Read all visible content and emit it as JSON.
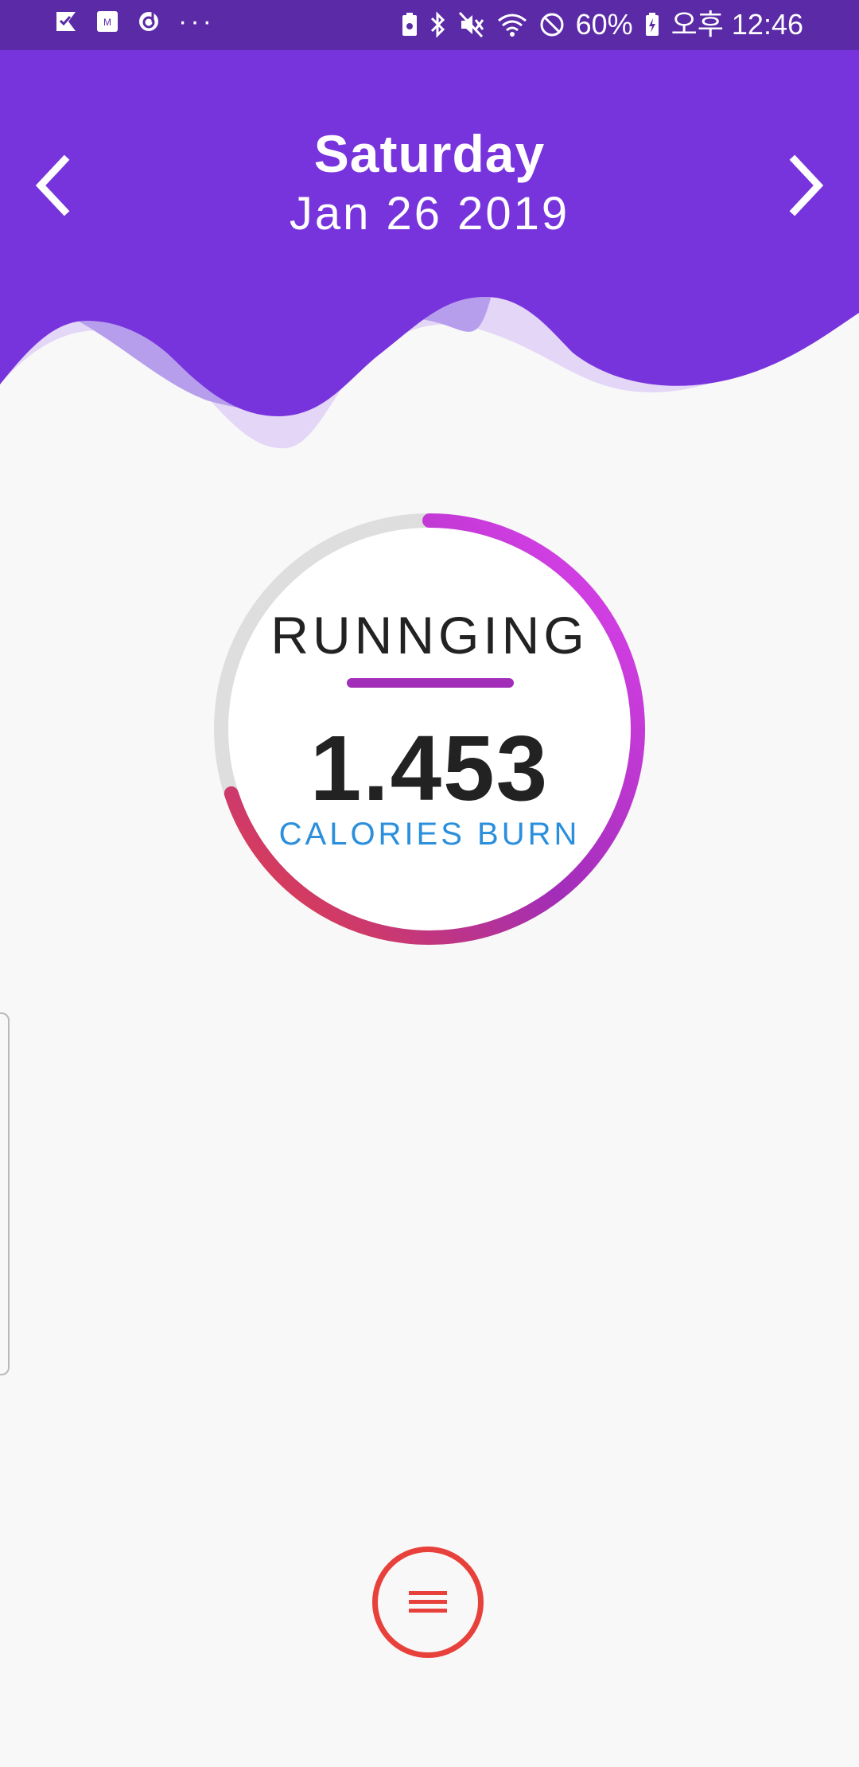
{
  "status_bar": {
    "left_icons": [
      "check-flag-icon",
      "mp-app-icon",
      "refresh-clock-icon"
    ],
    "more_indicator": "···",
    "right_icons": [
      "battery-saver-icon",
      "bluetooth-icon",
      "mute-icon",
      "wifi-icon",
      "block-icon"
    ],
    "battery_text": "60%",
    "time_text": "오후 12:46"
  },
  "header": {
    "day": "Saturday",
    "date": "Jan 26 2019",
    "prev_icon": "chevron-left-icon",
    "next_icon": "chevron-right-icon"
  },
  "activity": {
    "name": "RUNNGING",
    "value": "1.453",
    "unit": "CALORIES BURN",
    "progress_percent": 70
  },
  "menu": {
    "icon": "menu-icon"
  },
  "colors": {
    "header_purple": "#7834dc",
    "status_bar": "#5a2aa7",
    "ring_track": "#dedede",
    "ring_start": "#e8413b",
    "ring_mid": "#a22db8",
    "ring_end": "#e044f0",
    "accent_blue": "#2b8fdc",
    "menu_red": "#e8413b"
  }
}
